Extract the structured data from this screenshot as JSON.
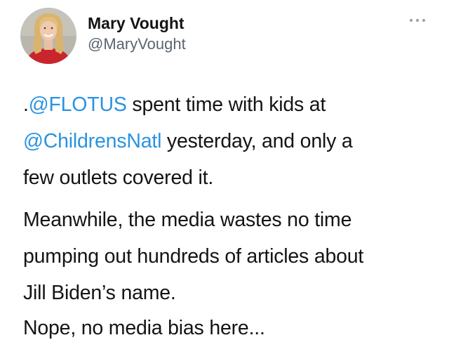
{
  "author": {
    "display_name": "Mary Vought",
    "handle": "@MaryVought"
  },
  "menu": {
    "icon": "more-horizontal-icon"
  },
  "tweet": {
    "paragraph_1": {
      "line_1": {
        "prefix": ".",
        "mention": "@FLOTUS",
        "text": " spent time with kids at"
      },
      "line_2": {
        "mention": "@ChildrensNatl",
        "text": " yesterday, and only a"
      },
      "line_3": "few outlets covered it."
    },
    "paragraph_2": {
      "line_1": "Meanwhile, the media wastes no time",
      "line_2": "pumping out hundreds of articles about",
      "line_3": "Jill Biden’s name."
    },
    "paragraph_3": {
      "line_1": "Nope, no media bias here..."
    }
  },
  "colors": {
    "mention": "#2a93e0",
    "text": "#141414",
    "handle": "#5b6570"
  }
}
